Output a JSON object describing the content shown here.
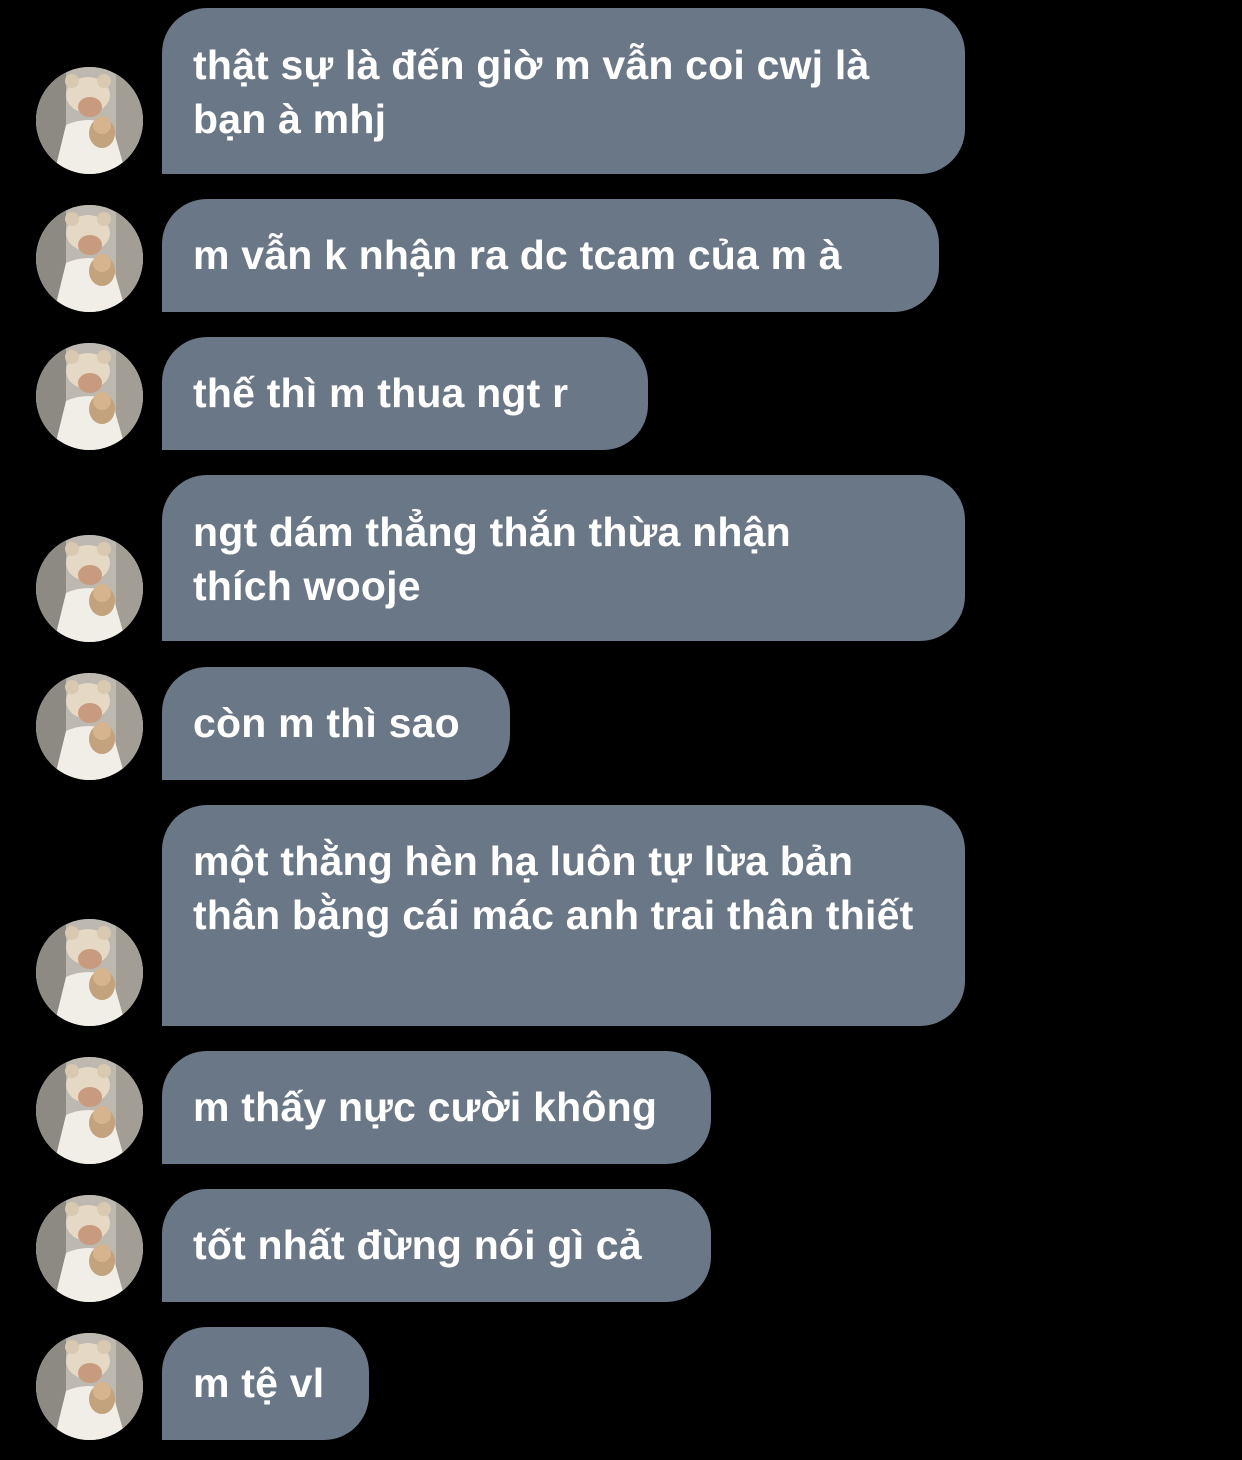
{
  "conversation": {
    "messages": [
      {
        "text": "thật sự là đến giờ m vẫn coi cwj là bạn à mhj",
        "avatar": "profile-avatar"
      },
      {
        "text": "m vẫn k nhận ra dc tcam của m à",
        "avatar": "profile-avatar"
      },
      {
        "text": "thế thì m thua ngt r",
        "avatar": "profile-avatar"
      },
      {
        "text": "ngt dám thẳng thắn thừa nhận thích wooje",
        "avatar": "profile-avatar"
      },
      {
        "text": "còn m thì sao",
        "avatar": "profile-avatar"
      },
      {
        "text": "một thằng hèn hạ luôn tự lừa bản thân bằng cái mác anh trai thân thiết",
        "avatar": "profile-avatar"
      },
      {
        "text": "m thấy nực cười không",
        "avatar": "profile-avatar"
      },
      {
        "text": "tốt nhất đừng nói gì cả",
        "avatar": "profile-avatar"
      },
      {
        "text": "m tệ vl",
        "avatar": "profile-avatar"
      }
    ]
  },
  "colors": {
    "background": "#000000",
    "bubble": "#6a7786",
    "text": "#ffffff"
  }
}
